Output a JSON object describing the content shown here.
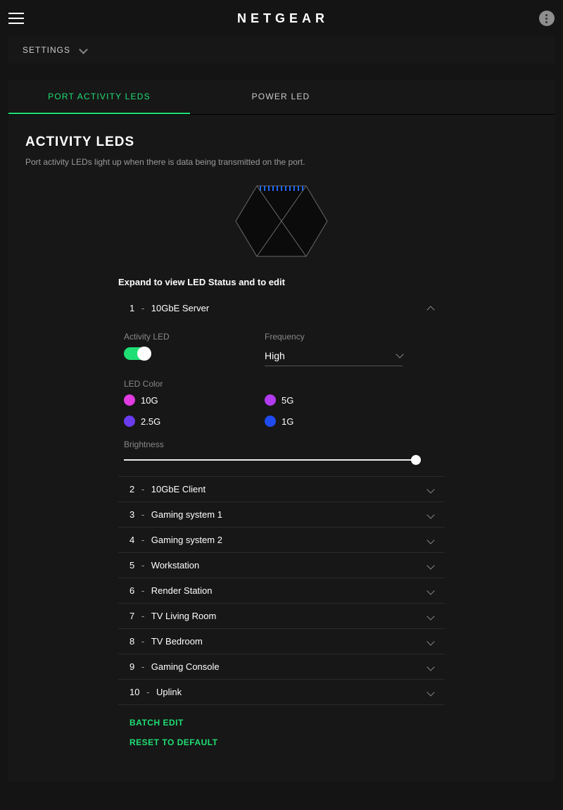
{
  "brand": "NETGEAR",
  "settings_bar": {
    "label": "SETTINGS"
  },
  "tabs": {
    "port_activity": "PORT ACTIVITY LEDS",
    "power_led": "POWER LED"
  },
  "page": {
    "title": "ACTIVITY LEDS",
    "description": "Port activity LEDs light up when there is data being transmitted on the port.",
    "expand_hint": "Expand to view LED Status and to edit"
  },
  "expanded": {
    "activity_led_label": "Activity LED",
    "frequency_label": "Frequency",
    "frequency_value": "High",
    "led_color_label": "LED Color",
    "brightness_label": "Brightness",
    "colors": [
      {
        "label": "10G",
        "hex": "#e23be2"
      },
      {
        "label": "5G",
        "hex": "#b13bf0"
      },
      {
        "label": "2.5G",
        "hex": "#6b3bf0"
      },
      {
        "label": "1G",
        "hex": "#1f4cf0"
      }
    ]
  },
  "ports": [
    {
      "num": "1",
      "name": "10GbE Server"
    },
    {
      "num": "2",
      "name": "10GbE Client"
    },
    {
      "num": "3",
      "name": "Gaming system 1"
    },
    {
      "num": "4",
      "name": "Gaming system 2"
    },
    {
      "num": "5",
      "name": "Workstation"
    },
    {
      "num": "6",
      "name": "Render Station"
    },
    {
      "num": "7",
      "name": "TV Living Room"
    },
    {
      "num": "8",
      "name": "TV Bedroom"
    },
    {
      "num": "9",
      "name": "Gaming Console"
    },
    {
      "num": "10",
      "name": "Uplink"
    }
  ],
  "actions": {
    "batch_edit": "BATCH EDIT",
    "reset_default": "RESET TO DEFAULT"
  }
}
